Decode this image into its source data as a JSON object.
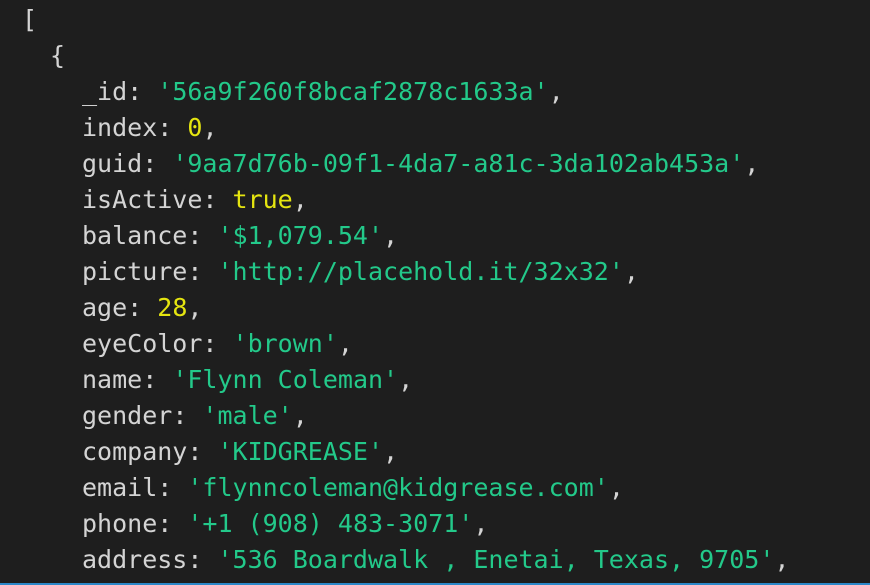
{
  "console": {
    "open_bracket": "[",
    "open_brace": "{",
    "entries": [
      {
        "key": "_id",
        "value": "'56a9f260f8bcaf2878c1633a'",
        "kind": "str"
      },
      {
        "key": "index",
        "value": "0",
        "kind": "num"
      },
      {
        "key": "guid",
        "value": "'9aa7d76b-09f1-4da7-a81c-3da102ab453a'",
        "kind": "str"
      },
      {
        "key": "isActive",
        "value": "true",
        "kind": "bool"
      },
      {
        "key": "balance",
        "value": "'$1,079.54'",
        "kind": "str"
      },
      {
        "key": "picture",
        "value": "'http://placehold.it/32x32'",
        "kind": "str"
      },
      {
        "key": "age",
        "value": "28",
        "kind": "num"
      },
      {
        "key": "eyeColor",
        "value": "'brown'",
        "kind": "str"
      },
      {
        "key": "name",
        "value": "'Flynn Coleman'",
        "kind": "str"
      },
      {
        "key": "gender",
        "value": "'male'",
        "kind": "str"
      },
      {
        "key": "company",
        "value": "'KIDGREASE'",
        "kind": "str"
      },
      {
        "key": "email",
        "value": "'flynncoleman@kidgrease.com'",
        "kind": "str"
      },
      {
        "key": "phone",
        "value": "'+1 (908) 483-3071'",
        "kind": "str"
      },
      {
        "key": "address",
        "value": "'536 Boardwalk , Enetai, Texas, 9705'",
        "kind": "str"
      }
    ]
  },
  "colors": {
    "background": "#1e1e1e",
    "text": "#d4d4d4",
    "string": "#23c98a",
    "number": "#e5e510",
    "boolean": "#e5e510",
    "accent_edge": "#2b88c9"
  }
}
